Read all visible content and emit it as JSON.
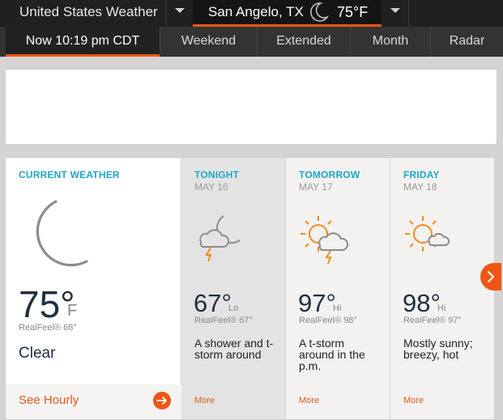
{
  "topbar": {
    "region": "United States Weather",
    "city": "San Angelo, TX",
    "temp": "75°F",
    "condition_icon": "moon-icon"
  },
  "nav": {
    "items": [
      {
        "label": "Now 10:19 pm CDT",
        "active": true
      },
      {
        "label": "Weekend"
      },
      {
        "label": "Extended"
      },
      {
        "label": "Month"
      },
      {
        "label": "Radar"
      }
    ]
  },
  "current": {
    "heading": "CURRENT WEATHER",
    "temp": "75°",
    "unit": "F",
    "realfeel": "RealFeel® 68°",
    "condition": "Clear",
    "hourly_label": "See Hourly",
    "icon": "moon-icon"
  },
  "forecast": [
    {
      "heading": "TONIGHT",
      "date": "MAY 16",
      "temp": "67°",
      "unit": "Lo",
      "realfeel": "RealFeel® 67°",
      "desc": "A shower and t-storm around",
      "more": "More",
      "icon": "night-storm-icon"
    },
    {
      "heading": "TOMORROW",
      "date": "MAY 17",
      "temp": "97°",
      "unit": "Hi",
      "realfeel": "RealFeel® 98°",
      "desc": "A t-storm around in the p.m.",
      "more": "More",
      "icon": "sun-storm-icon"
    },
    {
      "heading": "FRIDAY",
      "date": "MAY 18",
      "temp": "98°",
      "unit": "Hi",
      "realfeel": "RealFeel® 97°",
      "desc": "Mostly sunny; breezy, hot",
      "more": "More",
      "icon": "sun-cloud-icon"
    }
  ],
  "colors": {
    "accent": "#f05514",
    "heading": "#1fa8c4",
    "temp": "#1e2f40"
  }
}
